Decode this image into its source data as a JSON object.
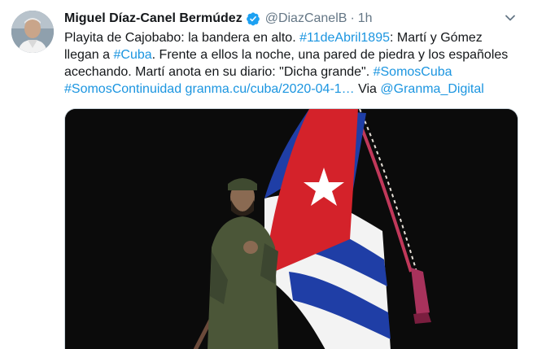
{
  "tweet": {
    "author_name": "Miguel Díaz-Canel Bermúdez",
    "handle": "@DiazCanelB",
    "separator": "·",
    "time": "1h",
    "text": {
      "t1": "Playita de Cajobabo: la bandera en alto. ",
      "tag1": "#11deAbril1895",
      "t2": ": Martí y Gómez llegan a ",
      "tag2": "#Cuba",
      "t3": ". Frente a ellos la noche, una pared de piedra y los españoles acechando. Martí anota en su diario: \"Dicha grande\". ",
      "tag3": "#SomosCuba",
      "tag4": "#SomosContinuidad",
      "url": "granma.cu/cuba/2020-04-1…",
      "t4": " Via ",
      "mention": "@Granma_Digital"
    }
  },
  "icons": {
    "verified": "verified-badge-icon",
    "menu": "chevron-down-icon"
  },
  "colors": {
    "link": "#1b95e0",
    "secondary_text": "#657786",
    "verified": "#1da1f2"
  }
}
